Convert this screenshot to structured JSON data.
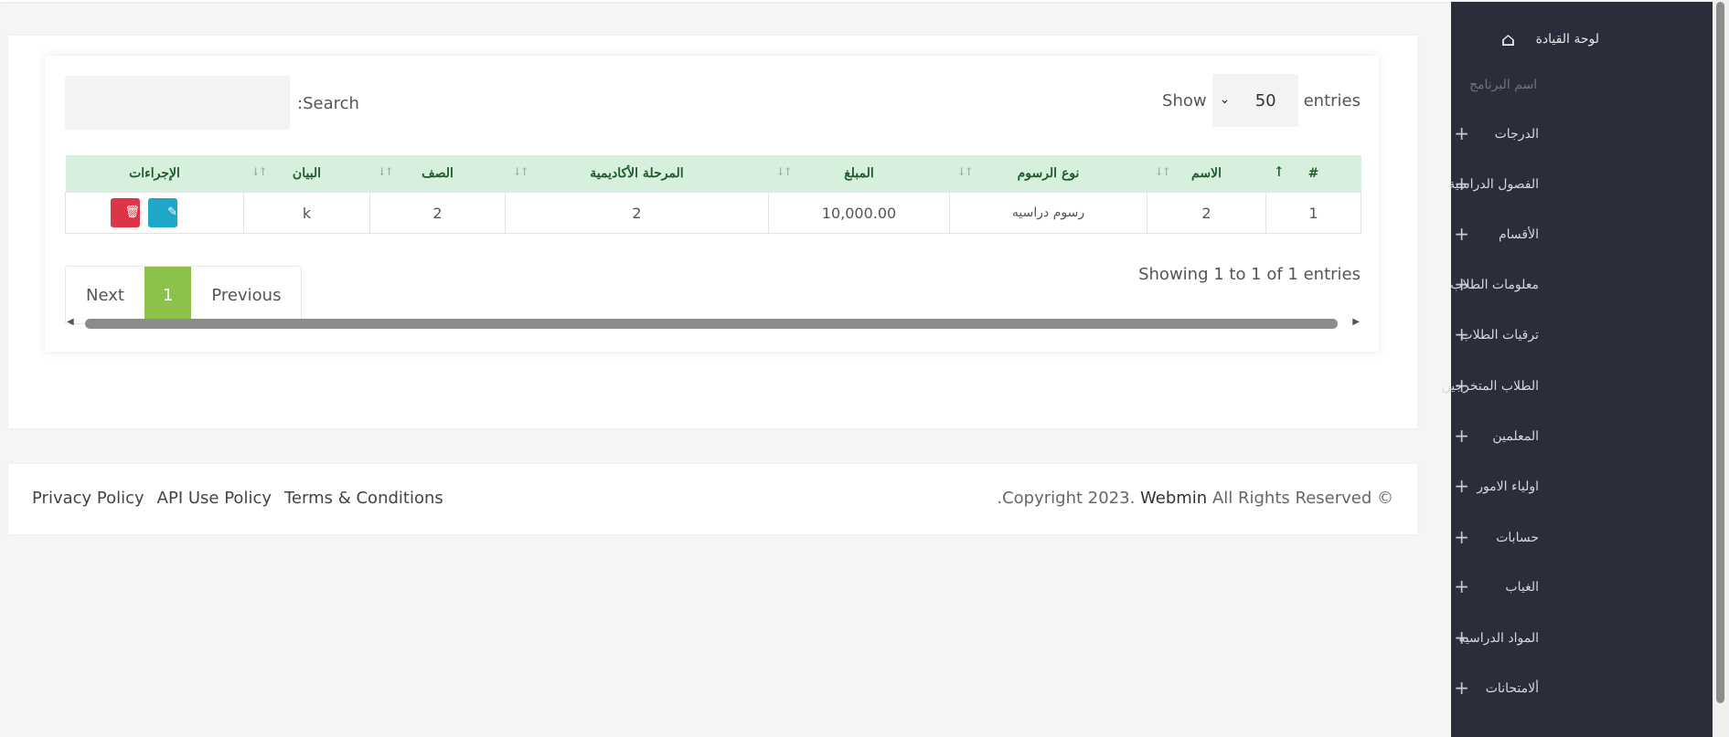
{
  "table_controls": {
    "search_label": ":Search",
    "search_value": "",
    "show_label": "Show",
    "entries_label": "entries",
    "page_length": "50"
  },
  "table": {
    "headers": [
      "#",
      "الاسم",
      "نوع الرسوم",
      "المبلغ",
      "المرحلة الأكاديمية",
      "الصف",
      "البيان",
      "الإجراءات"
    ],
    "rows": [
      {
        "num": "1",
        "name": "2",
        "fee_type": "رسوم دراسيه",
        "amount": "10,000.00",
        "stage": "2",
        "grade": "2",
        "statement": "k"
      }
    ]
  },
  "pagination": {
    "info": "Showing 1 to 1 of 1 entries",
    "previous": "Previous",
    "current": "1",
    "next": "Next"
  },
  "footer": {
    "links": [
      "Privacy Policy",
      "API Use Policy",
      "Terms & Conditions"
    ],
    "copyright_prefix": ".Copyright 2023.",
    "brand": "Webmin",
    "copyright_suffix": "All Rights Reserved ©"
  },
  "sidebar": {
    "dashboard": "لوحة القيادة",
    "section_title": "اسم البرنامج",
    "items": [
      "الدرجات",
      "الفصول الدراسية",
      "الأقسام",
      "معلومات الطلاب",
      "ترقيات الطلاب",
      "الطلاب المتخرجين",
      "المعلمين",
      "اولياء الامور",
      "حسابات",
      "الغياب",
      "المواد الدراسيه",
      "ألامتحانات"
    ]
  },
  "colors": {
    "sidebar_bg": "#2c2d3b",
    "table_header_bg": "#d7f0dd",
    "pagination_active": "#8bc34a",
    "edit_button": "#1fa7c9",
    "delete_button": "#dc3545"
  }
}
